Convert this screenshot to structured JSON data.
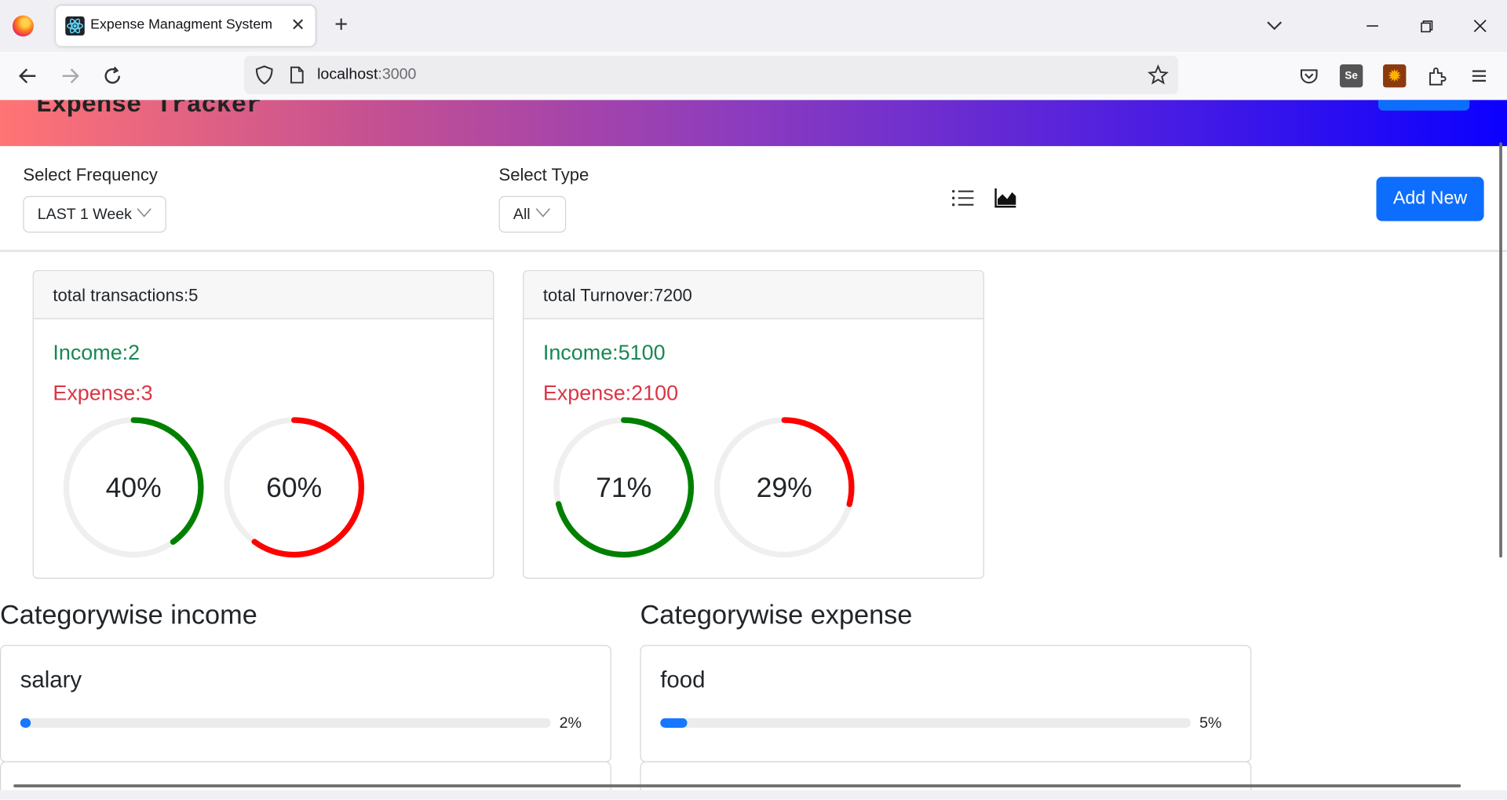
{
  "browser": {
    "tab_title": "Expense Managment System",
    "url_host": "localhost",
    "url_port": ":3000"
  },
  "app": {
    "title": "Expense Tracker"
  },
  "filters": {
    "frequency_label": "Select Frequency",
    "frequency_value": "LAST 1 Week",
    "type_label": "Select Type",
    "type_value": "All",
    "add_new_label": "Add New"
  },
  "summary": {
    "transactions": {
      "header": "total transactions:5",
      "income": "Income:2",
      "expense": "Expense:3",
      "income_percent": 40,
      "expense_percent": 60,
      "income_percent_label": "40%",
      "expense_percent_label": "60%"
    },
    "turnover": {
      "header": "total Turnover:7200",
      "income": "Income:5100",
      "expense": "Expense:2100",
      "income_percent": 71,
      "expense_percent": 29,
      "income_percent_label": "71%",
      "expense_percent_label": "29%"
    }
  },
  "categorywise_income": {
    "title": "Categorywise income",
    "items": [
      {
        "name": "salary",
        "percent": 2,
        "percent_label": "2%"
      }
    ]
  },
  "categorywise_expense": {
    "title": "Categorywise expense",
    "items": [
      {
        "name": "food",
        "percent": 5,
        "percent_label": "5%"
      }
    ]
  },
  "colors": {
    "income_ring": "#008000",
    "expense_ring": "#ff0000",
    "ring_track": "#efefef",
    "progress_fill": "#1677ff",
    "primary_button": "#0d6efd",
    "income_text": "#198754",
    "expense_text": "#dc3545"
  },
  "icons": {
    "list_view": "list-icon",
    "chart_view": "area-chart-icon"
  }
}
